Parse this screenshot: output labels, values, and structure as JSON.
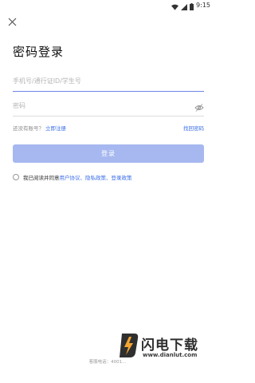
{
  "status_bar": {
    "time": "9:15",
    "icons": [
      "wifi-icon",
      "signal-icon",
      "battery-icon"
    ]
  },
  "header": {
    "close_icon": "close-icon",
    "title": "密码登录"
  },
  "form": {
    "phone_placeholder": "手机号/通行证ID/学生号",
    "password_placeholder": "密码",
    "password_toggle_icon": "eye-off-icon",
    "register_hint": "还没有账号？",
    "register_link": "立即注册",
    "forgot_link": "找回密码",
    "login_button": "登录"
  },
  "agreement": {
    "prefix": "我已阅读并同意",
    "links": [
      "用户协议、",
      "隐私政策、",
      "登录政策"
    ]
  },
  "footer": {
    "text": "客服电话：4001..."
  },
  "watermark": {
    "title": "闪电下载",
    "url": "www.dianlut.com"
  },
  "colors": {
    "accent": "#3a6ee8",
    "button_disabled": "#a7b8f0",
    "focused_underline": "#6f86e6",
    "watermark_logo": "#f3a531"
  }
}
